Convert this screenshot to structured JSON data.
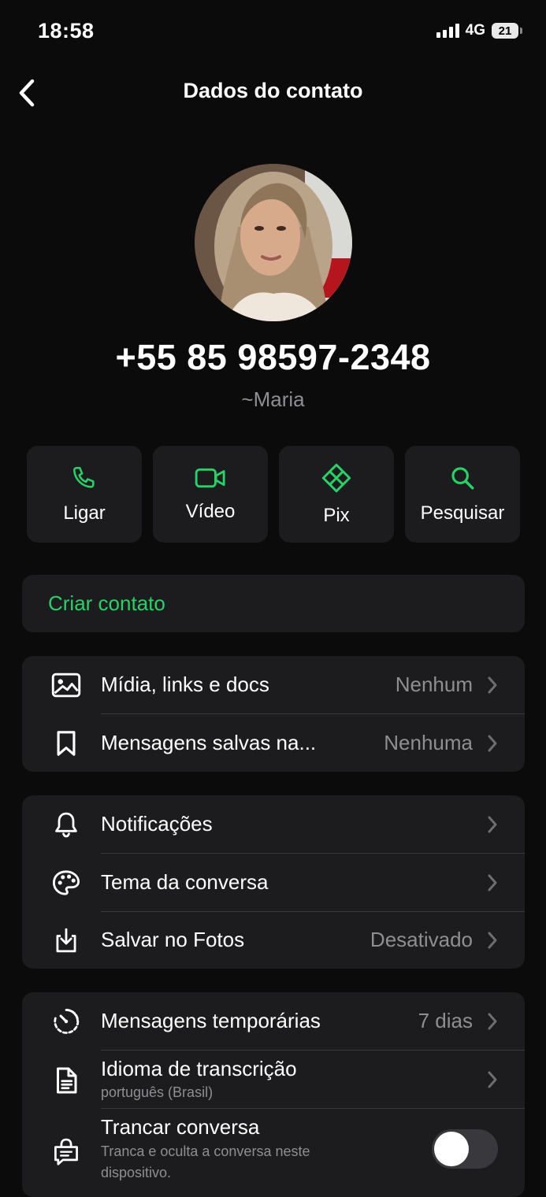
{
  "status_bar": {
    "time": "18:58",
    "network": "4G",
    "battery": "21"
  },
  "header": {
    "title": "Dados do contato"
  },
  "contact": {
    "phone": "+55 85 98597-2348",
    "name": "~Maria"
  },
  "actions": [
    {
      "label": "Ligar",
      "icon": "phone-icon"
    },
    {
      "label": "Vídeo",
      "icon": "video-icon"
    },
    {
      "label": "Pix",
      "icon": "pix-icon"
    },
    {
      "label": "Pesquisar",
      "icon": "search-icon"
    }
  ],
  "create_contact": {
    "label": "Criar contato"
  },
  "media_group": [
    {
      "label": "Mídia, links e docs",
      "value": "Nenhum",
      "icon": "image-icon"
    },
    {
      "label": "Mensagens salvas na...",
      "value": "Nenhuma",
      "icon": "bookmark-icon"
    }
  ],
  "settings_group": [
    {
      "label": "Notificações",
      "value": "",
      "icon": "bell-icon"
    },
    {
      "label": "Tema da conversa",
      "value": "",
      "icon": "palette-icon"
    },
    {
      "label": "Salvar no Fotos",
      "value": "Desativado",
      "icon": "save-download-icon"
    }
  ],
  "privacy_group": [
    {
      "label": "Mensagens temporárias",
      "value": "7 dias",
      "icon": "timer-icon"
    },
    {
      "label": "Idioma de transcrição",
      "sub": "português (Brasil)",
      "icon": "document-icon"
    },
    {
      "label": "Trancar conversa",
      "sub": "Tranca e oculta a conversa neste",
      "sub2": "dispositivo.",
      "icon": "chat-lock-icon",
      "toggle_on": false
    }
  ],
  "colors": {
    "accent": "#25d366",
    "card": "#1c1c1e",
    "background": "#0b0b0b",
    "secondary_text": "#8e8e93"
  }
}
